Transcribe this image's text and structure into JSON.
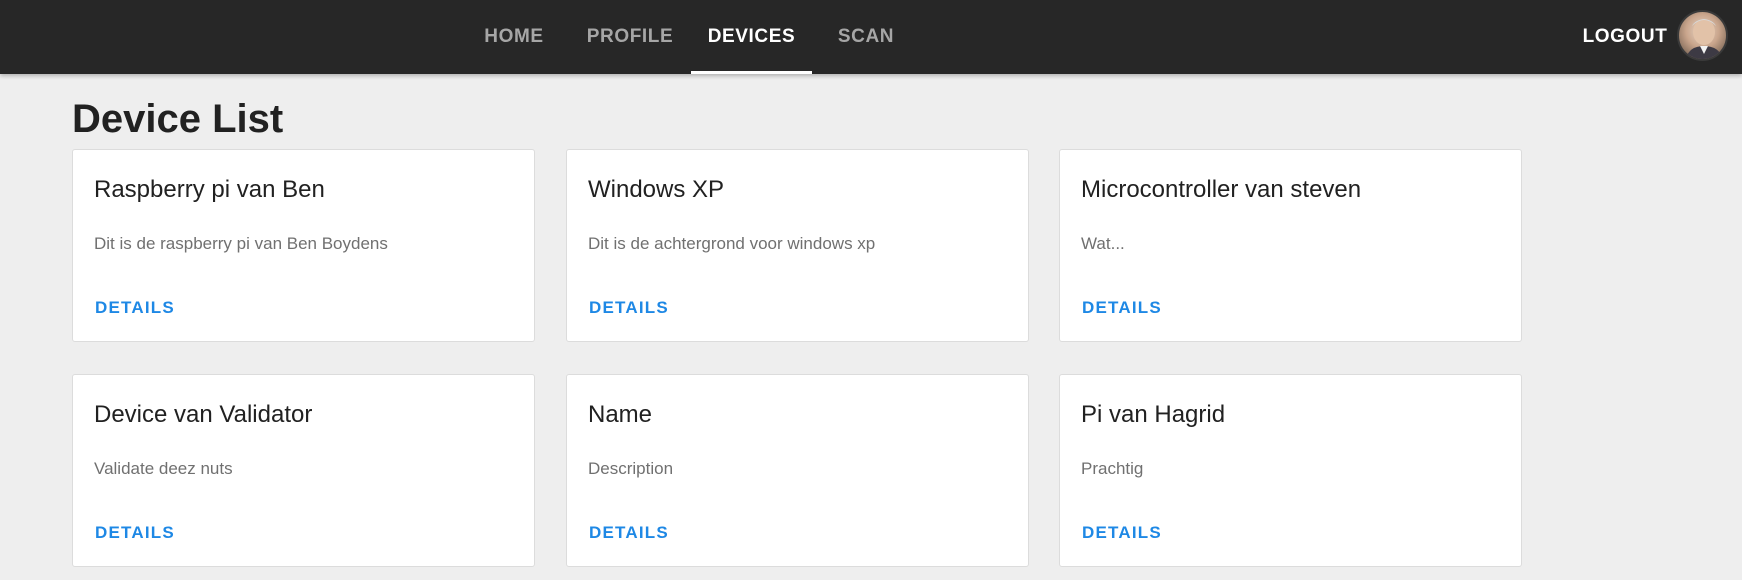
{
  "nav": {
    "tabs": [
      {
        "label": "HOME"
      },
      {
        "label": "PROFILE"
      },
      {
        "label": "DEVICES",
        "active": true
      },
      {
        "label": "SCAN"
      }
    ],
    "logout_label": "LOGOUT"
  },
  "page": {
    "title": "Device List"
  },
  "devices": [
    {
      "name": "Raspberry pi van Ben",
      "description": "Dit is de raspberry pi van Ben Boydens",
      "action": "DETAILS"
    },
    {
      "name": "Windows XP",
      "description": "Dit is de achtergrond voor windows xp",
      "action": "DETAILS"
    },
    {
      "name": "Microcontroller van steven",
      "description": "Wat...",
      "action": "DETAILS"
    },
    {
      "name": "Device van Validator",
      "description": "Validate deez nuts",
      "action": "DETAILS"
    },
    {
      "name": "Name",
      "description": "Description",
      "action": "DETAILS"
    },
    {
      "name": "Pi van Hagrid",
      "description": "Prachtig",
      "action": "DETAILS"
    }
  ],
  "colors": {
    "topbar": "#272727",
    "background": "#eeeeee",
    "accent": "#1e88e5"
  }
}
